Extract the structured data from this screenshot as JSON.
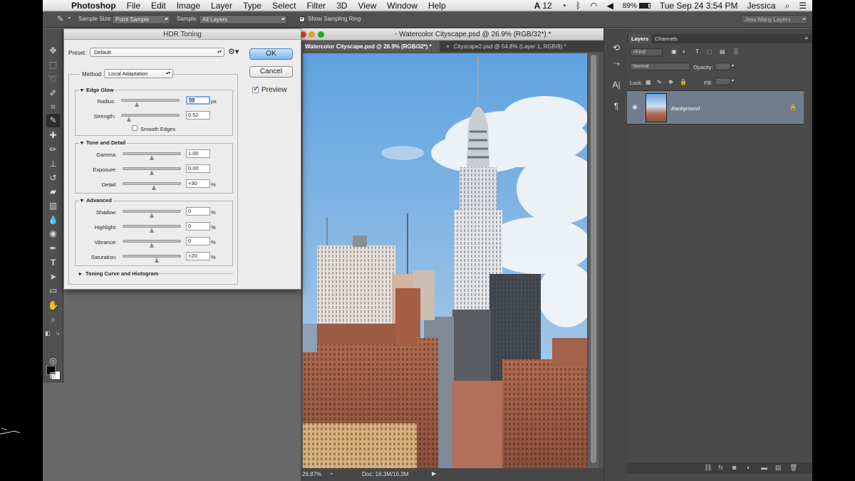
{
  "menubar": {
    "app_name": "Photoshop",
    "items": [
      "File",
      "Edit",
      "Image",
      "Layer",
      "Type",
      "Select",
      "Filter",
      "3D",
      "View",
      "Window",
      "Help"
    ],
    "status_num": "12",
    "battery": "89%",
    "datetime": "Tue Sep 24  3:54 PM",
    "user": "Jessica"
  },
  "options_bar": {
    "sample_size_label": "Sample Size:",
    "sample_size_value": "Point Sample",
    "sample_label": "Sample:",
    "sample_value": "All Layers",
    "show_ring_label": "Show Sampling Ring",
    "workspace": "Jess Many Layers"
  },
  "dialog": {
    "title": "HDR Toning",
    "preset_label": "Preset:",
    "preset_value": "Default",
    "ok": "OK",
    "cancel": "Cancel",
    "preview": "Preview",
    "method_label": "Method:",
    "method_value": "Local Adaptation",
    "edge_glow": {
      "title": "Edge Glow",
      "radius_label": "Radius:",
      "radius_value": "59",
      "radius_unit": "px",
      "radius_pos": 0.25,
      "strength_label": "Strength:",
      "strength_value": "0.52",
      "strength_pos": 0.1,
      "smooth_label": "Smooth Edges"
    },
    "tone_detail": {
      "title": "Tone and Detail",
      "gamma_label": "Gamma:",
      "gamma_value": "1.00",
      "gamma_pos": 0.5,
      "exposure_label": "Exposure:",
      "exposure_value": "0.00",
      "exposure_pos": 0.5,
      "detail_label": "Detail:",
      "detail_value": "+30",
      "detail_unit": "%",
      "detail_pos": 0.55
    },
    "advanced": {
      "title": "Advanced",
      "shadow_label": "Shadow:",
      "shadow_value": "0",
      "shadow_pos": 0.5,
      "highlight_label": "Highlight:",
      "highlight_value": "0",
      "highlight_pos": 0.5,
      "vibrance_label": "Vibrance:",
      "vibrance_value": "0",
      "vibrance_pos": 0.5,
      "saturation_label": "Saturation:",
      "saturation_value": "+20",
      "saturation_pos": 0.6,
      "pct": "%"
    },
    "toning_curve": "Toning Curve and Histogram"
  },
  "document": {
    "window_title": "Watercolor Cityscape.psd @ 26.9% (RGB/32*) *",
    "tab1": "Watercolor Cityscape.psd @ 26.9% (RGB/32*) *",
    "tab2": "Cityscape2.psd @ 54.8% (Layer 1, RGB/8) *",
    "zoom": "26.87%",
    "doc_size": "Doc: 16.3M/16.3M"
  },
  "layers_panel": {
    "tab_layers": "Layers",
    "tab_channels": "Channels",
    "kind": "Kind",
    "blend_mode": "Normal",
    "opacity_label": "Opacity:",
    "opacity_value": "100%",
    "lock_label": "Lock:",
    "fill_label": "Fill:",
    "fill_value": "100%",
    "layer_name": "Background"
  }
}
